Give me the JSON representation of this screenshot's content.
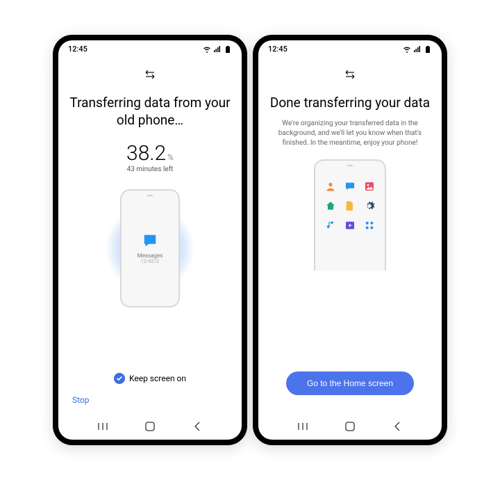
{
  "statusBar": {
    "time": "12:45"
  },
  "left": {
    "title": "Transferring data from your old phone…",
    "percent": "38.2",
    "percentSign": "%",
    "timeLeft": "43 minutes left",
    "currentCategory": "Messages",
    "categoryCount": "12/4372",
    "keepScreenOn": "Keep screen on",
    "stop": "Stop"
  },
  "right": {
    "title": "Done transferring your data",
    "subtitle": "We're organizing your transferred data in the background, and we'll let you know when that's finished. In the meantime, enjoy your phone!",
    "button": "Go to the Home screen"
  }
}
